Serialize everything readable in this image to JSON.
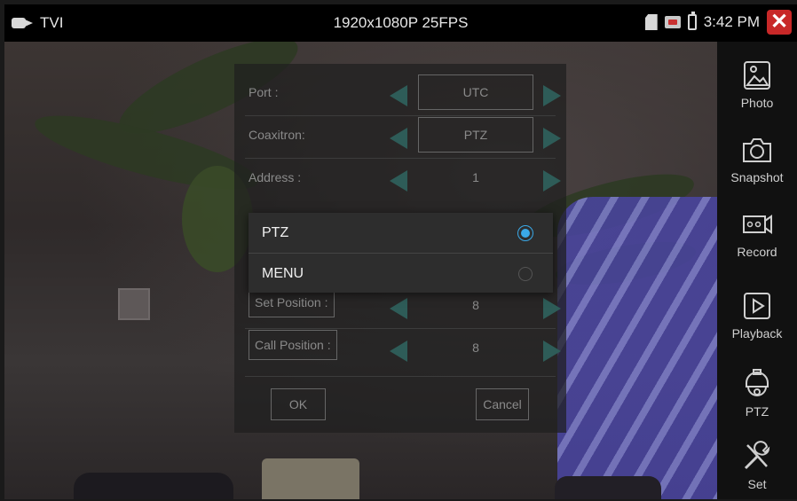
{
  "status_bar": {
    "mode_label": "TVI",
    "resolution": "1920x1080P 25FPS",
    "time": "3:42 PM",
    "close_symbol": "✕"
  },
  "sidebar": {
    "items": [
      {
        "label": "Photo",
        "icon": "photo-icon"
      },
      {
        "label": "Snapshot",
        "icon": "camera-icon"
      },
      {
        "label": "Record",
        "icon": "record-icon"
      },
      {
        "label": "Playback",
        "icon": "playback-icon"
      },
      {
        "label": "PTZ",
        "icon": "ptz-camera-icon"
      },
      {
        "label": "Set",
        "icon": "tools-icon"
      }
    ]
  },
  "dialog": {
    "rows": [
      {
        "label": "Port :",
        "value": "UTC"
      },
      {
        "label": "Coaxitron:",
        "value": "PTZ"
      },
      {
        "label": "Address :",
        "value": "1"
      },
      {
        "label": "Set Position :",
        "value": "8"
      },
      {
        "label": "Call Position :",
        "value": "8"
      }
    ],
    "ok_label": "OK",
    "cancel_label": "Cancel"
  },
  "popup": {
    "options": [
      {
        "label": "PTZ",
        "selected": true
      },
      {
        "label": "MENU",
        "selected": false
      }
    ]
  },
  "colors": {
    "accent_radio": "#3aa9e8",
    "arrow": "#2e5c58",
    "close": "#c82828"
  }
}
